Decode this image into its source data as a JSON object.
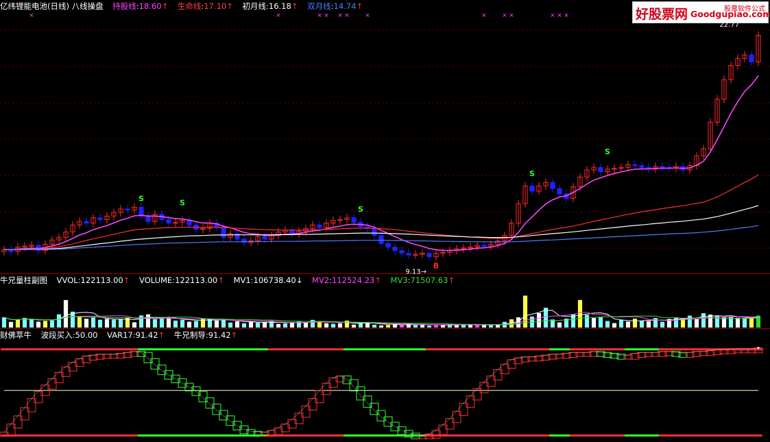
{
  "header": {
    "stock_title": "亿纬锂能电池(日线) 八线操盘",
    "ma_lines": [
      {
        "label": "持股线",
        "value": "18.60",
        "arrow": "↑",
        "color": "#ff44ff"
      },
      {
        "label": "生命线",
        "value": "17.10",
        "arrow": "↑",
        "color": "#ff4040"
      },
      {
        "label": "初月线",
        "value": "16.18",
        "arrow": "↑",
        "color": "#ffffff"
      },
      {
        "label": "双月线",
        "value": "14.74",
        "arrow": "↑",
        "color": "#4a7dff"
      }
    ]
  },
  "logo": {
    "cn": "好股票网",
    "en": "Goodgupiao.com",
    "tag": "股票软件公式"
  },
  "volume_header": {
    "title": "牛兄量柱副图",
    "items": [
      {
        "label": "VVOL",
        "value": "122113.00",
        "arrow": "↑",
        "color": "#ffffff"
      },
      {
        "label": "VOLUME",
        "value": "122113.00",
        "arrow": "↑",
        "color": "#ffffff"
      },
      {
        "label": "MV1",
        "value": "106738.40",
        "arrow": "↓",
        "color": "#ffffff"
      },
      {
        "label": "MV2",
        "value": "112524.23",
        "arrow": "↑",
        "color": "#ff44ff"
      },
      {
        "label": "MV3",
        "value": "71507.63",
        "arrow": "↑",
        "color": "#33dd33"
      }
    ]
  },
  "osc_header": {
    "title": "财佛萃牛",
    "items": [
      {
        "label": "波段买入",
        "value": "50.00",
        "arrow": "",
        "color": "#ffffff"
      },
      {
        "label": "VAR17",
        "value": "91.42",
        "arrow": "↑",
        "color": "#ffffff"
      },
      {
        "label": "牛兄制导",
        "value": "91.42",
        "arrow": "↑",
        "color": "#ffffff"
      }
    ]
  },
  "colors": {
    "up": "#ff2a2a",
    "down": "#2222ff",
    "ma_magenta": "#ff44ff",
    "ma_red": "#ff3030",
    "ma_white": "#ffffff",
    "ma_blue": "#4a7dff",
    "grid": "#7a0000",
    "vol_cyan": "#7fffff",
    "vol_yellow": "#ffff44",
    "vol_white": "#ffffff",
    "vol_magenta": "#ff44ff",
    "osc_red": "#ff3030",
    "osc_green": "#33ff33",
    "signal": "#33ff33"
  },
  "chart_data": {
    "type": "candlestick",
    "title": "亿纬锂能电池(日线) 八线操盘",
    "ylim": [
      8.5,
      23.2
    ],
    "low_annotation": {
      "text": "9.13",
      "value": 9.13,
      "index": 62
    },
    "high_annotation": {
      "text": "22.77",
      "value": 22.77,
      "index": 108
    },
    "x": [
      0,
      1,
      2,
      3,
      4,
      5,
      6,
      7,
      8,
      9,
      10,
      11,
      12,
      13,
      14,
      15,
      16,
      17,
      18,
      19,
      20,
      21,
      22,
      23,
      24,
      25,
      26,
      27,
      28,
      29,
      30,
      31,
      32,
      33,
      34,
      35,
      36,
      37,
      38,
      39,
      40,
      41,
      42,
      43,
      44,
      45,
      46,
      47,
      48,
      49,
      50,
      51,
      52,
      53,
      54,
      55,
      56,
      57,
      58,
      59,
      60,
      61,
      62,
      63,
      64,
      65,
      66,
      67,
      68,
      69,
      70,
      71,
      72,
      73,
      74,
      75,
      76,
      77,
      78,
      79,
      80,
      81,
      82,
      83,
      84,
      85,
      86,
      87,
      88,
      89,
      90,
      91,
      92,
      93,
      94,
      95,
      96,
      97,
      98,
      99,
      100,
      101,
      102,
      103,
      104,
      105,
      106,
      107,
      108,
      109,
      110
    ],
    "close": [
      9.8,
      9.7,
      9.95,
      10.0,
      10.05,
      9.75,
      10.1,
      10.35,
      10.5,
      10.8,
      11.2,
      11.4,
      11.3,
      11.6,
      11.5,
      11.7,
      11.9,
      12.1,
      12.05,
      12.2,
      11.7,
      11.4,
      11.8,
      11.5,
      11.3,
      11.35,
      11.45,
      11.2,
      10.95,
      11.0,
      11.3,
      11.05,
      10.5,
      10.7,
      10.4,
      10.2,
      10.3,
      10.55,
      10.4,
      10.6,
      10.8,
      10.9,
      10.7,
      10.85,
      11.0,
      11.2,
      11.05,
      11.3,
      11.45,
      11.5,
      11.6,
      11.35,
      11.1,
      11.0,
      10.6,
      10.15,
      9.95,
      9.75,
      9.6,
      9.5,
      9.55,
      9.6,
      9.4,
      9.6,
      9.65,
      9.75,
      9.85,
      9.9,
      9.95,
      10.05,
      10.0,
      10.1,
      10.3,
      10.6,
      11.3,
      12.4,
      13.4,
      13.1,
      13.4,
      13.6,
      13.25,
      12.95,
      12.7,
      13.35,
      13.9,
      14.3,
      14.45,
      14.2,
      14.35,
      14.4,
      14.45,
      14.6,
      14.55,
      14.45,
      14.35,
      14.5,
      14.45,
      14.4,
      14.5,
      14.3,
      14.55,
      15.1,
      15.5,
      17.0,
      18.3,
      19.4,
      20.2,
      20.6,
      20.8,
      20.4,
      21.9
    ],
    "ma_series": [
      {
        "name": "持股线",
        "values": [
          9.82,
          9.8,
          9.83,
          9.86,
          9.89,
          9.87,
          9.92,
          10.01,
          10.11,
          10.26,
          10.44,
          10.63,
          10.76,
          10.93,
          11.05,
          11.17,
          11.31,
          11.47,
          11.58,
          11.71,
          11.74,
          11.7,
          11.7,
          11.67,
          11.61,
          11.56,
          11.53,
          11.47,
          11.38,
          11.31,
          11.31,
          11.26,
          11.12,
          11.04,
          10.91,
          10.78,
          10.7,
          10.67,
          10.61,
          10.6,
          10.63,
          10.67,
          10.68,
          10.72,
          10.78,
          10.86,
          10.9,
          10.98,
          11.06,
          11.13,
          11.21,
          11.24,
          11.22,
          11.19,
          11.07,
          10.89,
          10.72,
          10.54,
          10.37,
          10.21,
          10.09,
          9.99,
          9.87,
          9.8,
          9.76,
          9.76,
          9.77,
          9.8,
          9.83,
          9.88,
          9.91,
          9.95,
          10.03,
          10.15,
          10.38,
          10.78,
          11.28,
          11.65,
          12.03,
          12.38,
          12.62,
          12.77,
          12.85,
          13.03,
          13.26,
          13.51,
          13.73,
          13.86,
          13.99,
          14.1,
          14.19,
          14.28,
          14.34,
          14.37,
          14.36,
          14.39,
          14.4,
          14.4,
          14.42,
          14.39,
          14.42,
          14.57,
          14.79,
          15.32,
          16.01,
          16.76,
          17.5,
          18.16,
          18.73,
          19.11,
          19.62
        ]
      },
      {
        "name": "生命线",
        "values": [
          9.81,
          9.8,
          9.81,
          9.83,
          9.85,
          9.84,
          9.86,
          9.91,
          9.96,
          10.04,
          10.13,
          10.23,
          10.32,
          10.42,
          10.5,
          10.58,
          10.67,
          10.76,
          10.84,
          10.92,
          10.96,
          10.98,
          11.01,
          11.03,
          11.05,
          11.06,
          11.07,
          11.08,
          11.07,
          11.06,
          11.07,
          11.07,
          11.05,
          11.03,
          11.01,
          10.98,
          10.96,
          10.95,
          10.93,
          10.92,
          10.91,
          10.91,
          10.91,
          10.9,
          10.91,
          10.92,
          10.93,
          10.95,
          10.96,
          10.98,
          11.0,
          11.01,
          11.02,
          11.02,
          11.01,
          10.99,
          10.96,
          10.93,
          10.89,
          10.84,
          10.8,
          10.76,
          10.71,
          10.67,
          10.63,
          10.6,
          10.57,
          10.54,
          10.51,
          10.49,
          10.47,
          10.45,
          10.45,
          10.45,
          10.48,
          10.54,
          10.63,
          10.71,
          10.79,
          10.87,
          10.94,
          11.01,
          11.07,
          11.14,
          11.22,
          11.31,
          11.4,
          11.48,
          11.56,
          11.64,
          11.72,
          11.8,
          11.87,
          11.94,
          12.0,
          12.06,
          12.12,
          12.18,
          12.23,
          12.28,
          12.34,
          12.41,
          12.49,
          12.62,
          12.78,
          12.97,
          13.17,
          13.39,
          13.6,
          13.79,
          14.03
        ]
      },
      {
        "name": "初月线",
        "values": [
          9.8,
          9.8,
          9.8,
          9.81,
          9.82,
          9.82,
          9.83,
          9.85,
          9.87,
          9.91,
          9.95,
          10.0,
          10.04,
          10.09,
          10.14,
          10.18,
          10.23,
          10.28,
          10.32,
          10.37,
          10.4,
          10.43,
          10.46,
          10.49,
          10.51,
          10.53,
          10.56,
          10.58,
          10.59,
          10.6,
          10.62,
          10.63,
          10.63,
          10.64,
          10.64,
          10.64,
          10.64,
          10.64,
          10.64,
          10.64,
          10.65,
          10.65,
          10.65,
          10.66,
          10.66,
          10.67,
          10.68,
          10.69,
          10.7,
          10.71,
          10.72,
          10.73,
          10.74,
          10.74,
          10.74,
          10.73,
          10.72,
          10.71,
          10.69,
          10.68,
          10.66,
          10.64,
          10.62,
          10.6,
          10.58,
          10.57,
          10.55,
          10.54,
          10.52,
          10.51,
          10.5,
          10.49,
          10.49,
          10.49,
          10.5,
          10.53,
          10.56,
          10.6,
          10.64,
          10.67,
          10.71,
          10.74,
          10.77,
          10.81,
          10.85,
          10.89,
          10.93,
          10.97,
          11.01,
          11.05,
          11.09,
          11.13,
          11.17,
          11.2,
          11.24,
          11.28,
          11.31,
          11.35,
          11.38,
          11.41,
          11.45,
          11.49,
          11.53,
          11.6,
          11.67,
          11.76,
          11.86,
          11.97,
          12.07,
          12.17,
          12.29
        ]
      },
      {
        "name": "双月线",
        "values": [
          9.8,
          9.8,
          9.8,
          9.8,
          9.81,
          9.81,
          9.81,
          9.82,
          9.83,
          9.85,
          9.87,
          9.9,
          9.92,
          9.94,
          9.97,
          9.99,
          10.01,
          10.04,
          10.06,
          10.09,
          10.1,
          10.12,
          10.14,
          10.15,
          10.17,
          10.18,
          10.19,
          10.2,
          10.21,
          10.22,
          10.23,
          10.24,
          10.25,
          10.25,
          10.25,
          10.26,
          10.26,
          10.26,
          10.26,
          10.27,
          10.27,
          10.27,
          10.27,
          10.28,
          10.28,
          10.29,
          10.29,
          10.3,
          10.3,
          10.31,
          10.32,
          10.32,
          10.33,
          10.33,
          10.33,
          10.33,
          10.33,
          10.32,
          10.32,
          10.31,
          10.3,
          10.3,
          10.29,
          10.28,
          10.27,
          10.27,
          10.26,
          10.26,
          10.25,
          10.25,
          10.25,
          10.24,
          10.24,
          10.24,
          10.25,
          10.26,
          10.28,
          10.3,
          10.32,
          10.34,
          10.35,
          10.37,
          10.39,
          10.41,
          10.43,
          10.45,
          10.47,
          10.49,
          10.51,
          10.53,
          10.55,
          10.57,
          10.59,
          10.61,
          10.63,
          10.65,
          10.67,
          10.69,
          10.71,
          10.72,
          10.74,
          10.76,
          10.79,
          10.82,
          10.86,
          10.9,
          10.95,
          11.0,
          11.05,
          11.1,
          11.16
        ]
      }
    ],
    "volume": {
      "ylim": [
        0,
        420000
      ],
      "values": [
        104737,
        57547,
        84525,
        98500,
        87643,
        59826,
        68012,
        72547,
        135112,
        281005,
        162450,
        108751,
        90132,
        102331,
        79854,
        87600,
        81225,
        83200,
        99870,
        53740,
        124210,
        135480,
        86212,
        92330,
        100420,
        71390,
        77930,
        59612,
        67400,
        93810,
        88600,
        70231,
        82140,
        51210,
        64440,
        43600,
        58230,
        49812,
        53120,
        69050,
        36780,
        42560,
        50210,
        61120,
        55100,
        78420,
        66100,
        43800,
        38760,
        44520,
        71140,
        30520,
        41800,
        54800,
        29050,
        21120,
        26810,
        31070,
        29520,
        40780,
        26190,
        27130,
        19270,
        30410,
        24700,
        35610,
        23800,
        30820,
        28740,
        27880,
        32550,
        28450,
        29190,
        57840,
        84320,
        104210,
        326220,
        112530,
        147280,
        202180,
        82680,
        52120,
        91140,
        138400,
        281640,
        129820,
        97710,
        105830,
        66730,
        45660,
        78850,
        61630,
        91200,
        70340,
        65440,
        97230,
        58620,
        88110,
        104710,
        96880,
        121530,
        89730,
        146570,
        131840,
        117490,
        103560,
        108840,
        99760,
        94520,
        95680,
        122113
      ],
      "colors": [
        "#7fffff",
        "#ffffff",
        "#ffff44",
        "#7fffff",
        "#7fffff",
        "#ffffff",
        "#ffff44",
        "#7fffff",
        "#7fffff",
        "#ffffff",
        "#7fffff",
        "#ffff44",
        "#ffffff",
        "#7fffff",
        "#7fffff",
        "#ffffff",
        "#7fffff",
        "#7fffff",
        "#ffff44",
        "#ffffff",
        "#7fffff",
        "#ffffff",
        "#7fffff",
        "#7fffff",
        "#ffffff",
        "#7fffff",
        "#7fffff",
        "#ffffff",
        "#7fffff",
        "#ffff44",
        "#7fffff",
        "#ffffff",
        "#7fffff",
        "#7fffff",
        "#ffffff",
        "#7fffff",
        "#ffffff",
        "#7fffff",
        "#ffffff",
        "#7fffff",
        "#ffffff",
        "#7fffff",
        "#ffffff",
        "#7fffff",
        "#ffffff",
        "#7fffff",
        "#ffff44",
        "#ffffff",
        "#7fffff",
        "#ffffff",
        "#ffff44",
        "#ffffff",
        "#7fffff",
        "#ffffff",
        "#7fffff",
        "#ffffff",
        "#ffff44",
        "#ffffff",
        "#ff44ff",
        "#ffffff",
        "#7fffff",
        "#ffffff",
        "#7fffff",
        "#ff44ff",
        "#ffffff",
        "#7fffff",
        "#ffffff",
        "#7fffff",
        "#ffffff",
        "#ff44ff",
        "#ffffff",
        "#7fffff",
        "#ffffff",
        "#7fffff",
        "#ffff44",
        "#ffffff",
        "#ffff44",
        "#7fffff",
        "#ffffff",
        "#7fffff",
        "#7fffff",
        "#ffffff",
        "#7fffff",
        "#7fffff",
        "#ffff44",
        "#7fffff",
        "#ffffff",
        "#7fffff",
        "#7fffff",
        "#ffffff",
        "#7fffff",
        "#ffffff",
        "#ffff44",
        "#7fffff",
        "#ffffff",
        "#7fffff",
        "#7fffff",
        "#ffffff",
        "#7fffff",
        "#ffff44",
        "#7fffff",
        "#ffffff",
        "#7fffff",
        "#ffffff",
        "#7fffff",
        "#ffffff",
        "#7fffff",
        "#ffffff",
        "#7fffff",
        "#ffff44",
        "#33dd33"
      ]
    },
    "oscillator": {
      "ylim": [
        0,
        105
      ],
      "buy_level": 50.0,
      "values": [
        4,
        13,
        22,
        31,
        41,
        49,
        56,
        63,
        70,
        76,
        81,
        85,
        88,
        89,
        90,
        90,
        90,
        91,
        92,
        93,
        92,
        85,
        78,
        72,
        67,
        63,
        58,
        54,
        49,
        42,
        35,
        28,
        22,
        16,
        11,
        7,
        5,
        4,
        4,
        6,
        9,
        13,
        18,
        25,
        33,
        41,
        50,
        58,
        64,
        66,
        62,
        54,
        44,
        36,
        28,
        21,
        15,
        10,
        6,
        3,
        1,
        1,
        2,
        6,
        12,
        19,
        27,
        36,
        44,
        52,
        59,
        66,
        73,
        79,
        84,
        86,
        87,
        87,
        88,
        89,
        90,
        90,
        91,
        92,
        92,
        92,
        93,
        92,
        91,
        90,
        89,
        89,
        91,
        92,
        92,
        92,
        93,
        93,
        92,
        91,
        92,
        93,
        93,
        94,
        95,
        95,
        96,
        96,
        96,
        96,
        97
      ],
      "state": [
        1,
        1,
        1,
        1,
        1,
        1,
        1,
        1,
        1,
        1,
        1,
        1,
        1,
        1,
        1,
        1,
        1,
        1,
        1,
        1,
        0,
        0,
        0,
        0,
        0,
        0,
        0,
        0,
        0,
        0,
        0,
        0,
        0,
        0,
        0,
        0,
        0,
        0,
        0,
        1,
        1,
        1,
        1,
        1,
        1,
        1,
        1,
        1,
        1,
        1,
        0,
        0,
        0,
        0,
        0,
        0,
        0,
        0,
        0,
        0,
        0,
        0,
        1,
        1,
        1,
        1,
        1,
        1,
        1,
        1,
        1,
        1,
        1,
        1,
        1,
        1,
        1,
        1,
        1,
        1,
        0,
        0,
        0,
        1,
        1,
        1,
        1,
        1,
        1,
        1,
        1,
        0,
        0,
        0,
        0,
        0,
        1,
        1,
        1,
        1,
        1,
        1,
        1,
        1,
        1,
        1,
        1,
        1,
        1,
        1,
        1
      ]
    },
    "signals": [
      {
        "text": "S",
        "index": 20
      },
      {
        "text": "S",
        "index": 26
      },
      {
        "text": "S",
        "index": 52
      },
      {
        "text": "S",
        "index": 77
      },
      {
        "text": "S",
        "index": 88
      },
      {
        "text": "B",
        "index": 63
      }
    ],
    "markers_x": [
      4,
      40,
      46,
      47,
      49,
      50,
      53,
      70,
      73,
      74,
      80,
      81,
      82
    ]
  }
}
